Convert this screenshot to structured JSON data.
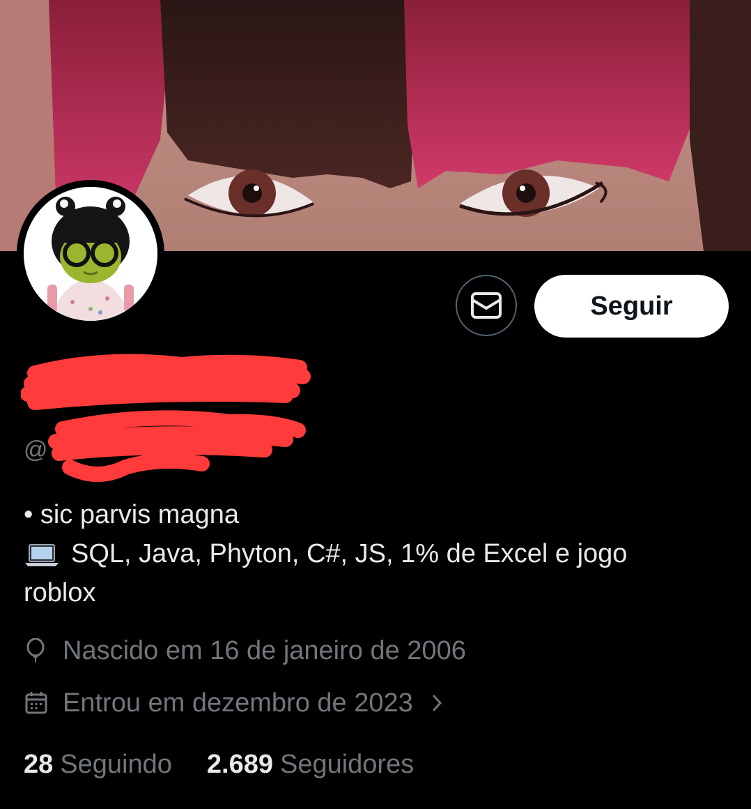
{
  "profile": {
    "handle_prefix": "@",
    "bio_line1": "• sic parvis magna",
    "bio_line2": "SQL, Java, Phyton, C#, JS, 1% de Excel e jogo",
    "bio_line3": "roblox",
    "birth": "Nascido em 16 de janeiro de 2006",
    "joined": "Entrou em dezembro de 2023"
  },
  "actions": {
    "follow_label": "Seguir"
  },
  "stats": {
    "following_count": "28",
    "following_label": "Seguindo",
    "followers_count": "2.689",
    "followers_label": "Seguidores"
  },
  "icons": {
    "message": "envelope-icon",
    "birthday": "balloon-icon",
    "joined": "calendar-icon",
    "chevron": "chevron-right-icon",
    "bio_emoji": "laptop-icon"
  },
  "colors": {
    "background": "#000000",
    "primary_text": "#e7e9ea",
    "secondary_text": "#71767b",
    "follow_button_bg": "#ffffff",
    "redaction": "#ff3b3b"
  }
}
